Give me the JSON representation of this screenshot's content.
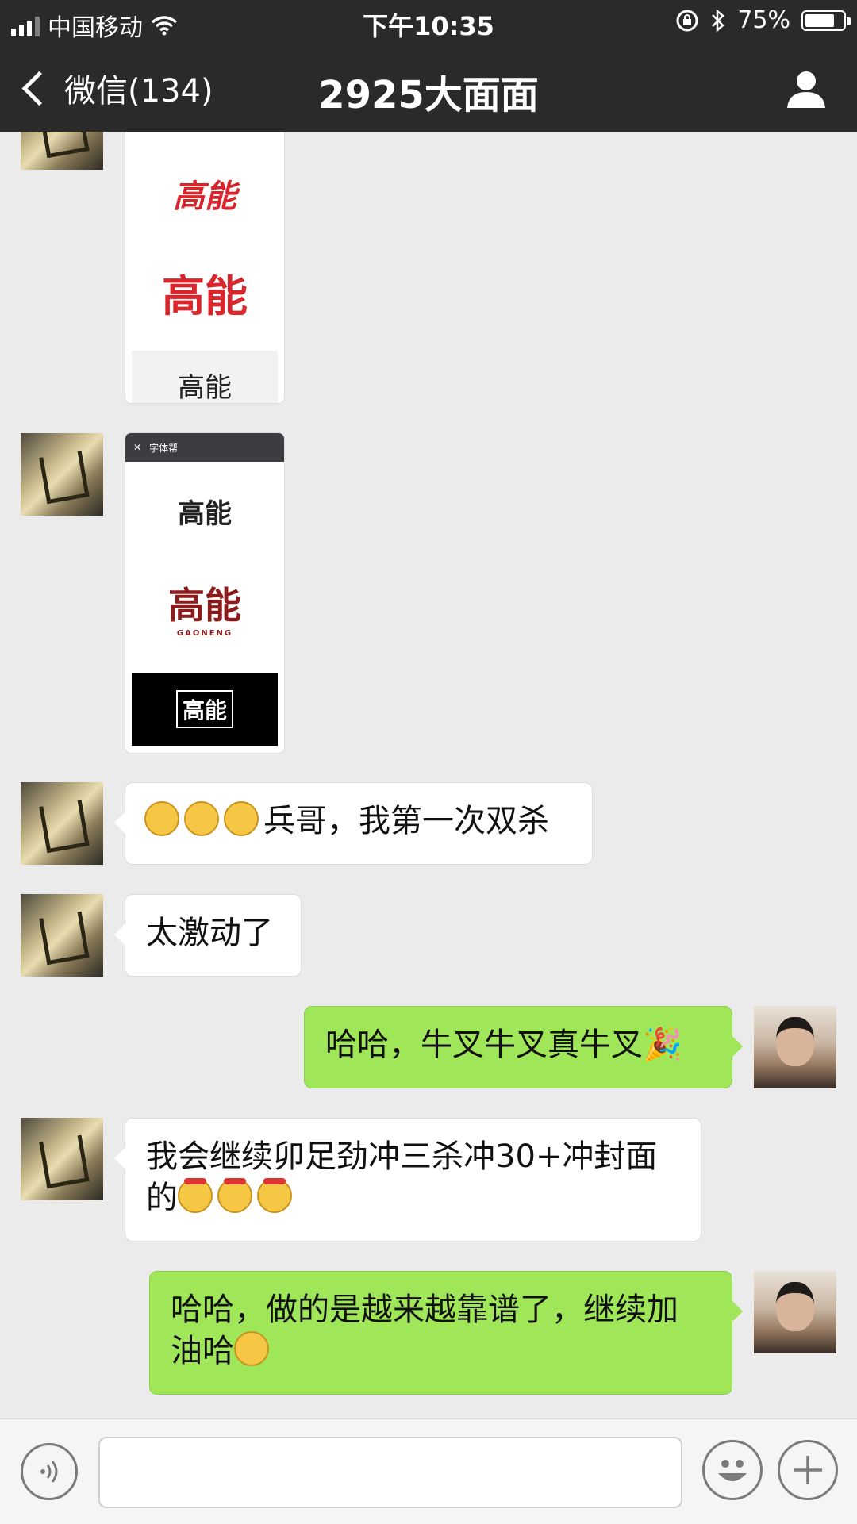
{
  "status_bar": {
    "carrier": "中国移动",
    "time": "下午10:35",
    "battery": "75%",
    "battery_level": 0.75,
    "icons": [
      "signal-icon",
      "wifi-icon",
      "lock-rotation-icon",
      "bluetooth-icon",
      "battery-icon"
    ]
  },
  "nav": {
    "back_label": "微信(134)",
    "title": "2925大面面",
    "contact_icon": "user-icon"
  },
  "messages": [
    {
      "type": "image",
      "sender": "friend",
      "content": [
        "高能",
        "高能",
        "高能"
      ]
    },
    {
      "type": "image",
      "sender": "friend",
      "header": "字体帮",
      "content": [
        "高能",
        "高能",
        "GAONENG",
        "高能"
      ]
    },
    {
      "type": "text",
      "sender": "friend",
      "emoji_prefix": [
        "grin-emoji",
        "grin-emoji",
        "grin-emoji"
      ],
      "text": "兵哥，我第一次双杀"
    },
    {
      "type": "text",
      "sender": "friend",
      "text": "太激动了"
    },
    {
      "type": "text",
      "sender": "me",
      "text": "哈哈，牛叉牛叉真牛叉",
      "emoji_suffix": "party-popper-emoji"
    },
    {
      "type": "text",
      "sender": "friend",
      "line1": "我会继续卯足劲冲三杀冲30+冲封面",
      "line2": "的",
      "emoji_suffix": [
        "determined-emoji",
        "determined-emoji",
        "determined-emoji"
      ]
    },
    {
      "type": "text",
      "sender": "me",
      "line1": "哈哈，做的是越来越靠谱了，继续加",
      "line2": "油哈",
      "emoji_suffix": "thinking-emoji"
    }
  ],
  "input_bar": {
    "voice_icon": "voice-icon",
    "emoji_icon": "smiley-icon",
    "more_icon": "plus-icon",
    "text_value": ""
  }
}
